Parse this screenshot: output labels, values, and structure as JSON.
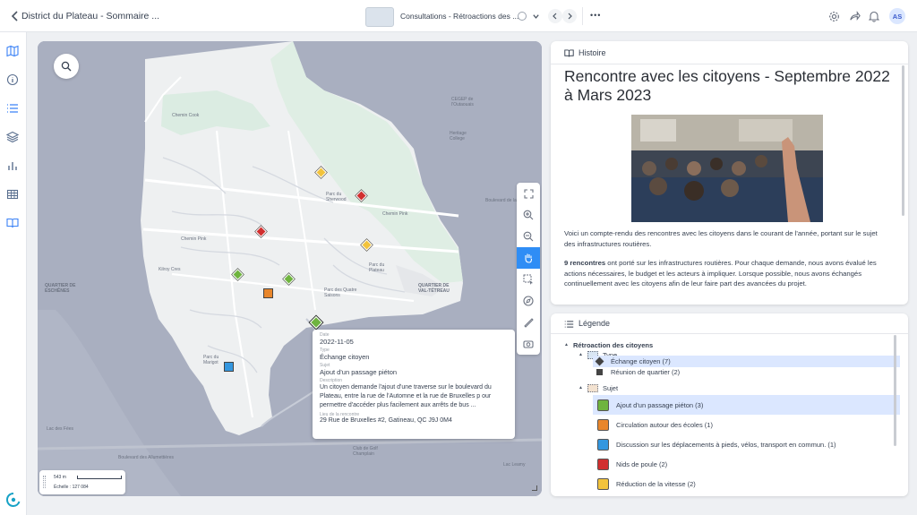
{
  "topbar": {
    "back_title": "District du Plateau - Sommaire ...",
    "center_title": "Consultations - Rétroactions des ...",
    "more_label": "•••",
    "avatar_initials": "AS"
  },
  "map": {
    "scale_distance": "543 m",
    "scale_ratio": "Échelle : 127 084",
    "streets": [
      {
        "text": "Chemin Cook"
      },
      {
        "text": "Chemin Pink"
      },
      {
        "text": "Chemin Pink"
      },
      {
        "text": "Kilroy Cres"
      },
      {
        "text": "Parc du Sherwood"
      },
      {
        "text": "Parc du Plateau"
      },
      {
        "text": "Parc des Quatre Saisons"
      },
      {
        "text": "Parc du Marigot"
      },
      {
        "text": "QUARTIER DE VAL-TÉTREAU"
      },
      {
        "text": "QUARTIER DE ESCHÊNES"
      },
      {
        "text": "Boulevard des Allumettières"
      },
      {
        "text": "Club de Golf Champlain"
      },
      {
        "text": "Lac des Fées"
      },
      {
        "text": "Lac Leamy"
      },
      {
        "text": "CEGEP de l'Outaouais"
      },
      {
        "text": "Heritage College"
      },
      {
        "text": "Boulevard de la Carrière"
      }
    ],
    "popup": {
      "date_label": "Date",
      "date_value": "2022-11-05",
      "type_label": "Type",
      "type_value": "Échange citoyen",
      "subject_label": "Sujet",
      "subject_value": "Ajout d'un passage piéton",
      "description_label": "Description",
      "description_value": "Un citoyen demande l'ajout d'une traverse sur le boulevard du Plateau, entre la rue de l'Automne et la rue de Bruxelles p our permettre d'accéder plus facilement aux arrêts de bus ...",
      "place_label": "Lieu de la rencontre",
      "place_value": "29 Rue de Bruxelles #2, Gatineau, QC J9J 0M4"
    },
    "markers": [
      {
        "color": "#f2c33c"
      },
      {
        "color": "#d12f2f"
      },
      {
        "color": "#d12f2f"
      },
      {
        "color": "#f2c33c"
      },
      {
        "color": "#6fb43f"
      },
      {
        "color": "#6fb43f"
      },
      {
        "color": "#e8862b"
      },
      {
        "color": "#6fb43f"
      },
      {
        "color": "#3497df"
      }
    ]
  },
  "story": {
    "header": "Histoire",
    "title": "Rencontre avec les citoyens - Septembre 2022 à Mars 2023",
    "paragraph1": "Voici un compte-rendu des rencontres avec les citoyens dans le courant de l'année, portant sur le sujet des infrastructures routières.",
    "p2_bold": "9 rencontres",
    "p2_rest": " ont porté sur les infrastructures routières. Pour chaque demande, nous avons évalué les actions nécessaires, le budget et les acteurs à impliquer. Lorsque possible, nous avons échangés continuellement avec les citoyens afin de leur faire part des avancées du projet."
  },
  "legend": {
    "header": "Légende",
    "root": "Rétroaction des citoyens",
    "type_group": "Type",
    "type_items": [
      {
        "label": "Échange citoyen (7)"
      },
      {
        "label": "Réunion de quartier (2)"
      }
    ],
    "subject_group": "Sujet",
    "subject_items": [
      {
        "label": "Ajout d'un passage piéton (3)",
        "color": "#6fb43f"
      },
      {
        "label": "Circulation autour des écoles (1)",
        "color": "#e8862b"
      },
      {
        "label": "Discussion sur les déplacements à pieds, vélos, transport en commun. (1)",
        "color": "#3497df"
      },
      {
        "label": "Nids de poule (2)",
        "color": "#d12f2f"
      },
      {
        "label": "Réduction de la vitesse (2)",
        "color": "#f2c33c"
      }
    ]
  }
}
